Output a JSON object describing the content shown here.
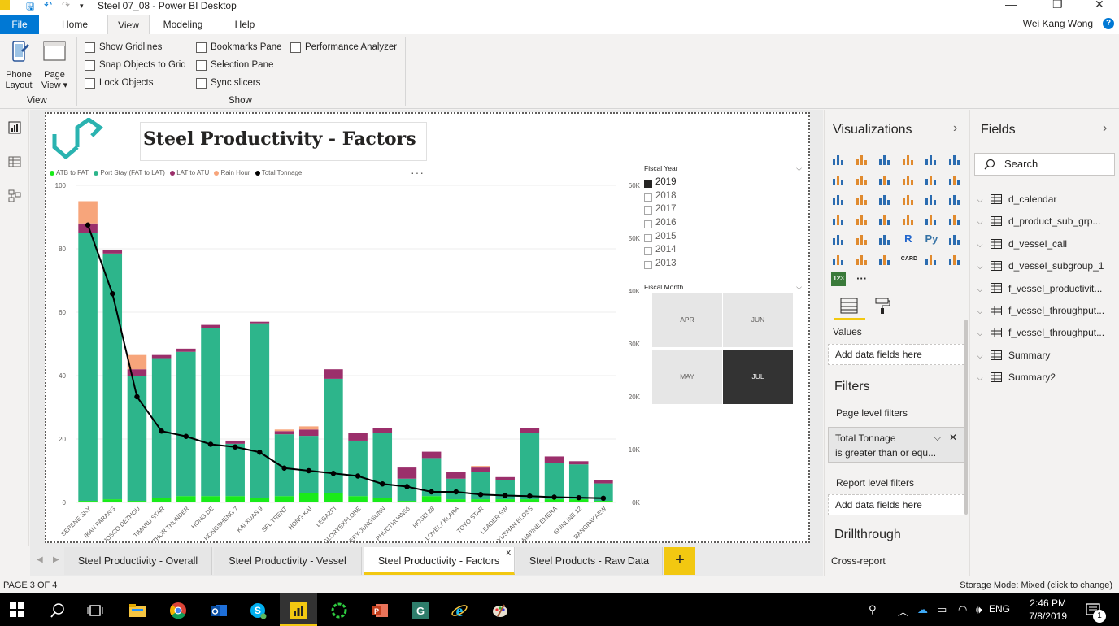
{
  "window": {
    "title": "Steel 07_08 - Power BI Desktop",
    "user": "Wei Kang Wong",
    "help": "?",
    "controls": [
      "—",
      "❐",
      "✕"
    ]
  },
  "menu": {
    "file": "File",
    "tabs": [
      "Home",
      "View",
      "Modeling",
      "Help"
    ]
  },
  "ribbon": {
    "phone_layout": [
      "Phone",
      "Layout"
    ],
    "page_view": [
      "Page",
      "View ▾"
    ],
    "view_group": "View",
    "show_group": "Show",
    "checks": {
      "show_gridlines": "Show Gridlines",
      "snap_objects": "Snap Objects to Grid",
      "lock_objects": "Lock Objects",
      "bookmarks_pane": "Bookmarks Pane",
      "selection_pane": "Selection Pane",
      "sync_slicers": "Sync slicers",
      "performance_analyzer": "Performance Analyzer"
    }
  },
  "report": {
    "title": "Steel Productivity - Factors",
    "more": "···"
  },
  "chart_data": {
    "type": "bar",
    "stacked": true,
    "legend_position": "top-left",
    "categories": [
      "SERENE SKY",
      "IKAN PARANG",
      "JOSCO DEZHOU",
      "TIMARU STAR",
      "THOR THUNDER",
      "HONG DE",
      "HONGSHENG 7",
      "KAI XUAN 9",
      "SFL TRENT",
      "HONG KAI",
      "LEGAZPI",
      "GLORYEXPLORE",
      "DERYOUNGSUNN",
      "PHUCTHUAN56",
      "HOSEI 28",
      "LOVELY KLARA",
      "TOYO STAR",
      "LEADER SW",
      "YUSHAN BLOSS",
      "MARINE EMERA",
      "SHINLINE 12",
      "BANGPAKAEW"
    ],
    "series": [
      {
        "name": "ATB to FAT",
        "color": "#1aeb1a",
        "values": [
          0.5,
          1,
          0.5,
          1.5,
          2,
          2,
          2,
          1.5,
          2,
          3,
          3,
          2,
          1.5,
          0.5,
          2,
          1,
          1,
          1,
          1,
          1,
          1,
          0.5
        ]
      },
      {
        "name": "Port Stay (FAT to LAT)",
        "color": "#2db58b",
        "values": [
          84.5,
          77.5,
          39.5,
          44,
          45.5,
          53,
          16.5,
          55,
          19.5,
          18,
          36,
          17.5,
          20.5,
          7,
          12,
          6.5,
          8.5,
          6,
          21,
          11.5,
          11,
          5.5
        ]
      },
      {
        "name": "LAT to ATU",
        "color": "#9b2f6b",
        "values": [
          3,
          1,
          2,
          1,
          1,
          1,
          1,
          0.5,
          1,
          2,
          3,
          2.5,
          1.5,
          3.5,
          2,
          2,
          1.5,
          1,
          1.5,
          2,
          1,
          1
        ]
      },
      {
        "name": "Rain Hour",
        "color": "#f7a57b",
        "values": [
          7,
          0,
          4.5,
          0,
          0,
          0,
          0,
          0,
          0.5,
          1,
          0,
          0,
          0,
          0,
          0,
          0,
          0.5,
          0,
          0,
          0,
          0,
          0
        ]
      }
    ],
    "line": {
      "name": "Total Tonnage",
      "color": "#000000",
      "values": [
        52500,
        39500,
        20000,
        13500,
        12500,
        11000,
        10500,
        9500,
        6500,
        6000,
        5500,
        5000,
        3500,
        3000,
        2000,
        2000,
        1500,
        1300,
        1200,
        1000,
        900,
        800
      ]
    },
    "y_left": {
      "min": 0,
      "max": 100,
      "ticks": [
        0,
        20,
        40,
        60,
        80,
        100
      ]
    },
    "y_right": {
      "min": 0,
      "max": 60000,
      "ticks": [
        "0K",
        "10K",
        "20K",
        "30K",
        "40K",
        "50K",
        "60K"
      ]
    },
    "grid": true
  },
  "slicer_year": {
    "header": "Fiscal Year",
    "items": [
      "2019",
      "2018",
      "2017",
      "2016",
      "2015",
      "2014",
      "2013"
    ],
    "selected": "2019"
  },
  "slicer_month": {
    "header": "Fiscal Month",
    "tiles": [
      "APR",
      "JUN",
      "MAY",
      "JUL"
    ],
    "selected": "JUL"
  },
  "page_tabs": {
    "tabs": [
      "Steel Productivity - Overall",
      "Steel Productivity - Vessel",
      "Steel Productivity - Factors",
      "Steel Products - Raw Data"
    ],
    "active": "Steel Productivity - Factors",
    "close": "x",
    "add": "+"
  },
  "visualizations": {
    "title": "Visualizations",
    "values_label": "Values",
    "add_fields": "Add data fields here",
    "card_label": "CARD",
    "r_label": "R",
    "py_label": "Py",
    "num_label": "123",
    "more": "···"
  },
  "filters": {
    "title": "Filters",
    "page_level": "Page level filters",
    "card_title": "Total Tonnage",
    "card_condition": "is greater than or equ...",
    "report_level": "Report level filters",
    "add_fields": "Add data fields here",
    "drillthrough": "Drillthrough",
    "cross_report": "Cross-report"
  },
  "fields": {
    "title": "Fields",
    "search_placeholder": "Search",
    "tables": [
      "d_calendar",
      "d_product_sub_grp...",
      "d_vessel_call",
      "d_vessel_subgroup_1",
      "f_vessel_productivit...",
      "f_vessel_throughput...",
      "f_vessel_throughput...",
      "Summary",
      "Summary2"
    ]
  },
  "status": {
    "page": "PAGE 3 OF 4",
    "storage": "Storage Mode: Mixed (click to change)"
  },
  "taskbar": {
    "lang": "ENG",
    "time": "2:46 PM",
    "date": "7/8/2019",
    "notif_count": "1"
  }
}
